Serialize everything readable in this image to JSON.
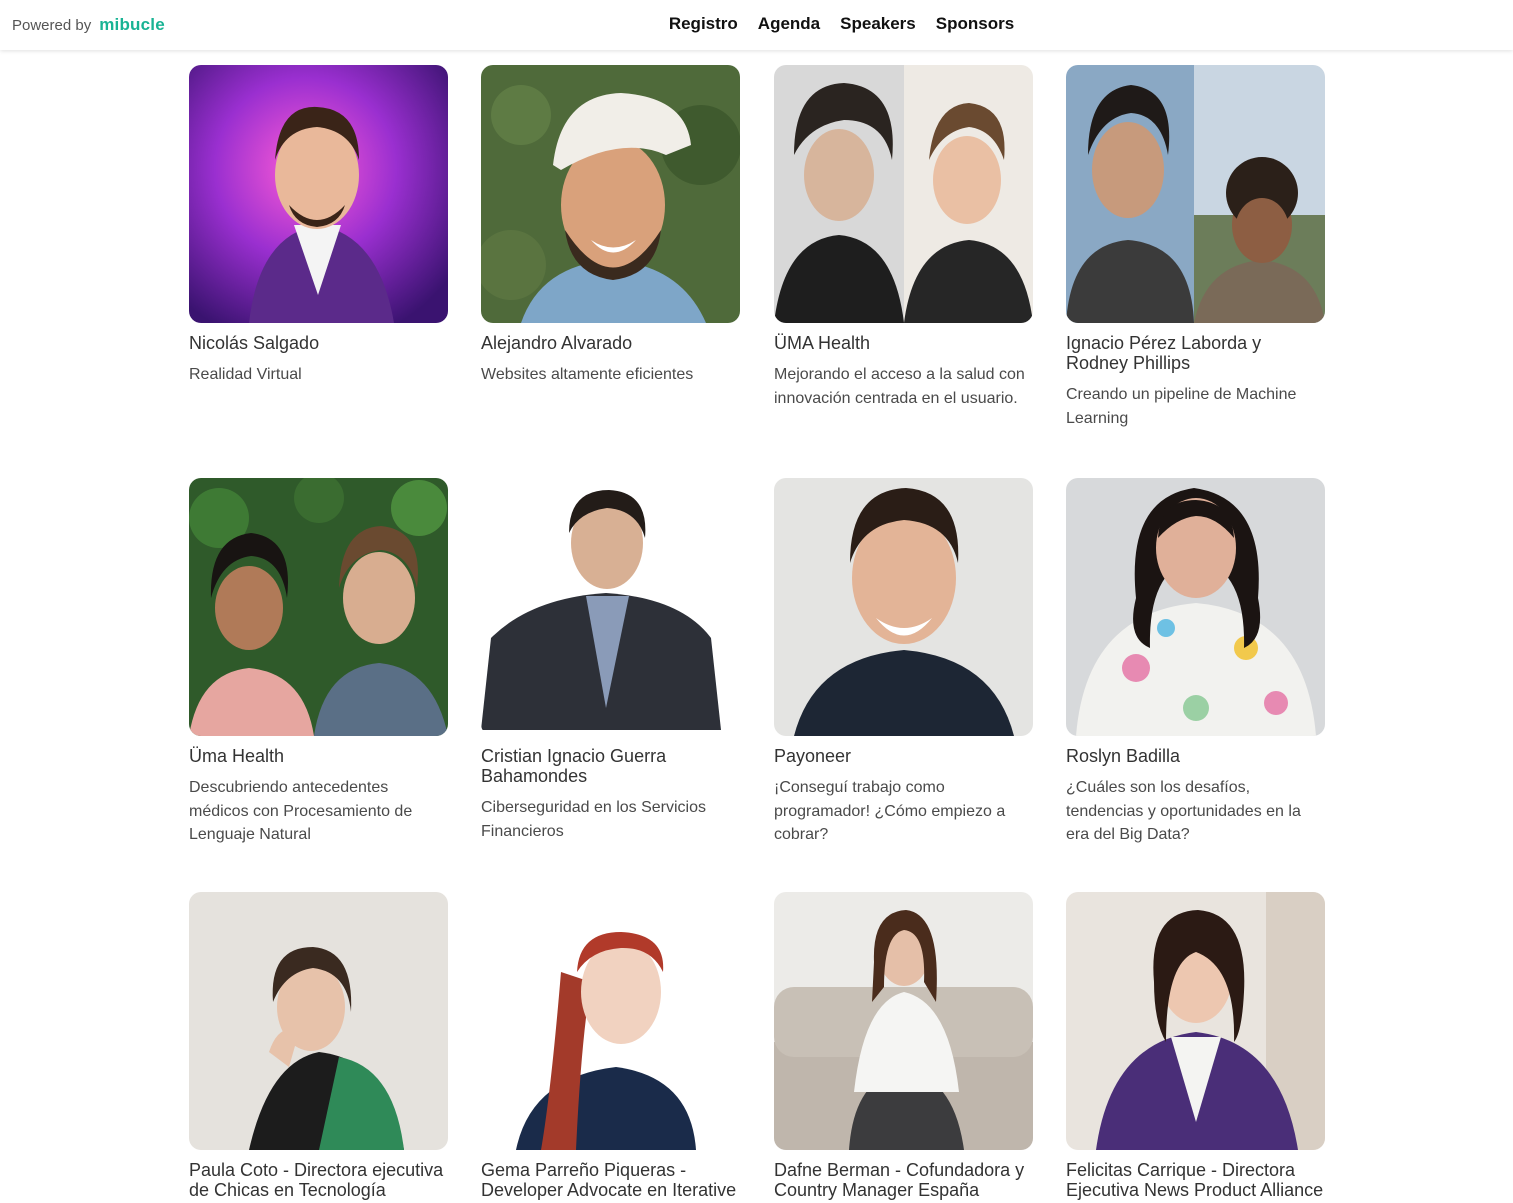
{
  "header": {
    "powered_by": "Powered by",
    "brand": "mibucle",
    "nav": [
      "Registro",
      "Agenda",
      "Speakers",
      "Sponsors"
    ]
  },
  "speakers": [
    {
      "name": "Nicolás Salgado",
      "talk": "Realidad Virtual",
      "photo": "portrait-purple-background"
    },
    {
      "name": "Alejandro Alvarado",
      "talk": "Websites altamente eficientes",
      "photo": "portrait-cap-hedge"
    },
    {
      "name": "ÜMA Health",
      "talk": "Mejorando el acceso a la salud con innovación centrada en el usuario.",
      "photo": "two-portraits-grey"
    },
    {
      "name": "Ignacio Pérez Laborda y Rodney Phillips",
      "talk": "Creando un pipeline de Machine Learning",
      "photo": "two-portraits-outdoor"
    },
    {
      "name": "Üma Health",
      "talk": "Descubriendo antecedentes médicos con Procesamiento de Lenguaje Natural",
      "photo": "two-portraits-plants"
    },
    {
      "name": "Cristian Ignacio Guerra Bahamondes",
      "talk": "Ciberseguridad en los Servicios Financieros",
      "photo": "portrait-suit-white"
    },
    {
      "name": "Payoneer",
      "talk": "¡Conseguí trabajo como programador! ¿Cómo empiezo a cobrar?",
      "photo": "portrait-young-man"
    },
    {
      "name": "Roslyn Badilla",
      "talk": "¿Cuáles son los desafíos, tendencias y oportunidades en la era del Big Data?",
      "photo": "portrait-floral-shirt"
    },
    {
      "name": "Paula Coto - Directora ejecutiva de Chicas en Tecnología",
      "talk": "",
      "photo": "portrait-green-top"
    },
    {
      "name": "Gema Parreño Piqueras - Developer Advocate en Iterative",
      "talk": "",
      "photo": "portrait-red-hair"
    },
    {
      "name": "Dafne Berman - Cofundadora y Country Manager España",
      "talk": "",
      "photo": "portrait-sofa"
    },
    {
      "name": "Felicitas Carrique - Directora Ejecutiva News Product Alliance",
      "talk": "",
      "photo": "portrait-plaid-blazer"
    }
  ]
}
